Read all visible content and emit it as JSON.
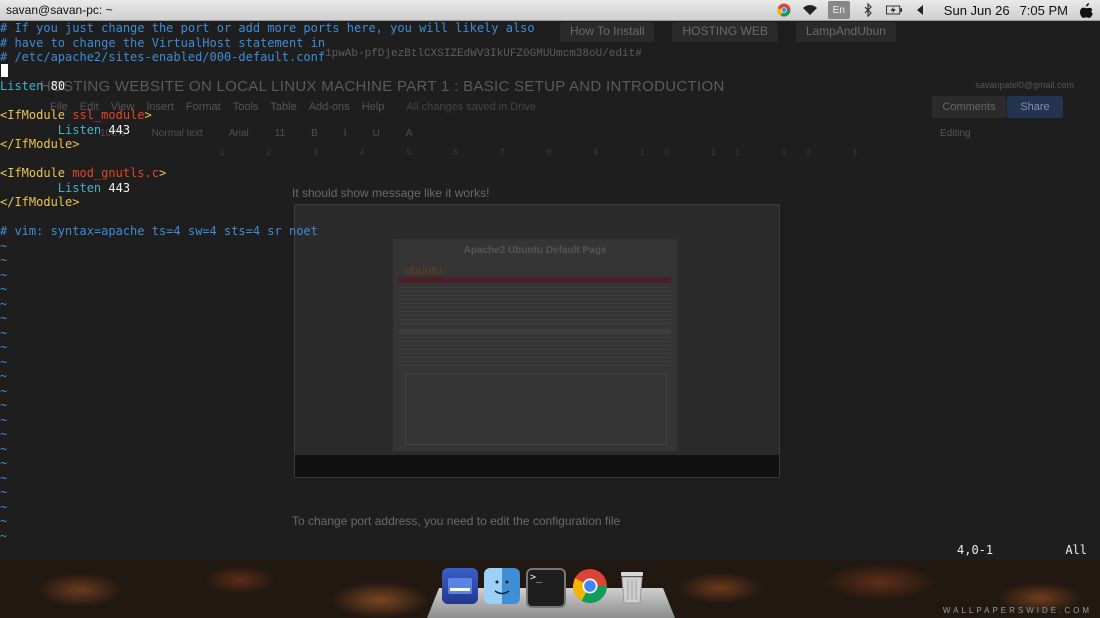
{
  "menubar": {
    "window_title": "savan@savan-pc: ~",
    "language": "En",
    "date": "Sun Jun 26",
    "time": "7:05 PM"
  },
  "background": {
    "tabs": [
      "How To Install",
      "HOSTING WEB",
      "LampAndUbun"
    ],
    "url": "1pwAb-pfDjezBtlCXSIZEdWV3IkUFZ0GMUUmcm38oU/edit#",
    "doc_title": "HOSTING WEBSITE ON LOCAL LINUX MACHINE PART 1 : BASIC SETUP AND INTRODUCTION",
    "menu": [
      "File",
      "Edit",
      "View",
      "Insert",
      "Format",
      "Tools",
      "Table",
      "Add-ons",
      "Help"
    ],
    "save_status": "All changes saved in Drive",
    "toolbar": [
      "100%",
      "Normal text",
      "Arial",
      "11",
      "B",
      "I",
      "U",
      "A"
    ],
    "account": "savanpatel0@gmail.com",
    "comments_label": "Comments",
    "share_label": "Share",
    "editing_label": "Editing",
    "ruler": "1 2 3 4 5 6 7 8 9 10 11 12 13 14 15 16 17 18",
    "paragraph_1": "It should show message like it works!",
    "paragraph_2": "To change port address, you need to edit the configuration file",
    "embedded_heading": "Apache2 Ubuntu Default Page",
    "embedded_logo": "ubuntu"
  },
  "vim": {
    "lines": [
      {
        "type": "comment",
        "text": "# If you just change the port or add more ports here, you will likely also"
      },
      {
        "type": "comment",
        "text": "# have to change the VirtualHost statement in"
      },
      {
        "type": "comment",
        "text": "# /etc/apache2/sites-enabled/000-default.conf"
      },
      {
        "type": "empty",
        "text": ""
      },
      {
        "type": "listen",
        "directive": "Listen",
        "value": "80",
        "indent": ""
      },
      {
        "type": "empty",
        "text": ""
      },
      {
        "type": "open",
        "tag": "<IfModule",
        "module": "ssl_module",
        "close": ">"
      },
      {
        "type": "listen",
        "directive": "Listen",
        "value": "443",
        "indent": "        "
      },
      {
        "type": "close",
        "text": "</IfModule>"
      },
      {
        "type": "empty",
        "text": ""
      },
      {
        "type": "open",
        "tag": "<IfModule",
        "module": "mod_gnutls.c",
        "close": ">"
      },
      {
        "type": "listen",
        "directive": "Listen",
        "value": "443",
        "indent": "        "
      },
      {
        "type": "close",
        "text": "</IfModule>"
      },
      {
        "type": "empty",
        "text": ""
      },
      {
        "type": "comment",
        "text": "# vim: syntax=apache ts=4 sw=4 sts=4 sr noet"
      }
    ],
    "tilde_count": 21,
    "tilde": "~",
    "cursor_position": "4,0-1",
    "scroll_percent": "All",
    "colors": {
      "comment": "#3d8cd6",
      "keyword": "#e8c64e",
      "module": "#e0442e",
      "directive": "#3eb2c8",
      "value": "#f2f2f2"
    }
  },
  "dock": {
    "apps": [
      {
        "name": "files",
        "icon": "files-icon"
      },
      {
        "name": "finder",
        "icon": "finder-icon"
      },
      {
        "name": "terminal",
        "icon": "terminal-icon",
        "label": ">_"
      },
      {
        "name": "chrome",
        "icon": "chrome-icon"
      },
      {
        "name": "trash",
        "icon": "trash-icon"
      }
    ]
  },
  "watermark": "WALLPAPERSWIDE.COM"
}
